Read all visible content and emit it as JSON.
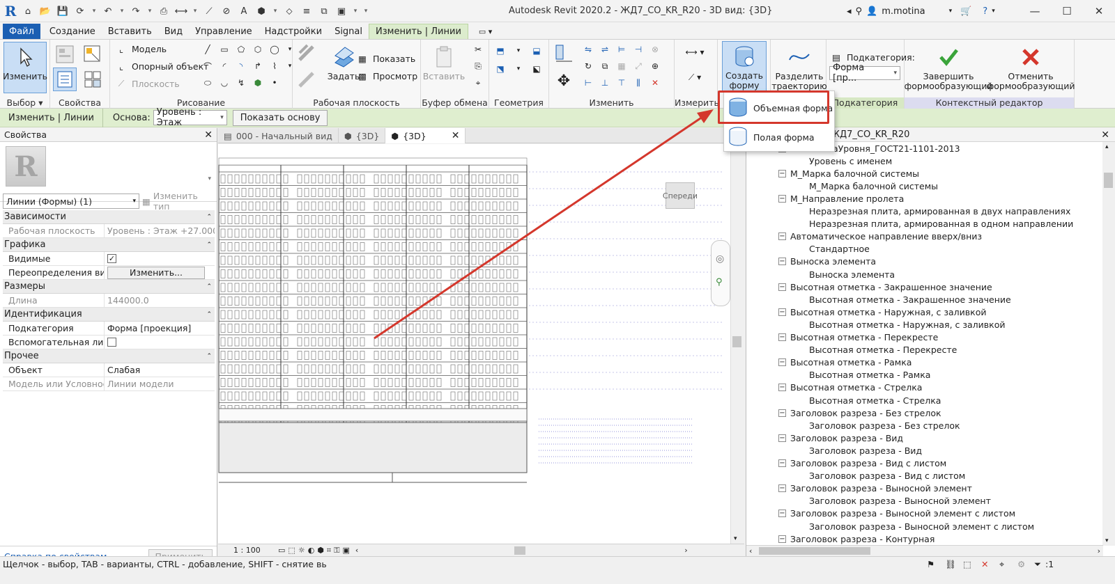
{
  "app": {
    "title": "Autodesk Revit 2020.2 - ЖД7_CO_KR_R20 - 3D вид: {3D}",
    "user": "m.motina"
  },
  "ribbon_tabs": [
    {
      "label": "Файл"
    },
    {
      "label": "Создание"
    },
    {
      "label": "Вставить"
    },
    {
      "label": "Вид"
    },
    {
      "label": "Управление"
    },
    {
      "label": "Надстройки"
    },
    {
      "label": "Signal"
    },
    {
      "label": "Изменить | Линии"
    }
  ],
  "ribbon": {
    "modify_label": "Изменить",
    "select_panel": "Выбор",
    "properties_panel": "Свойства",
    "draw": {
      "model": "Модель",
      "ref": "Опорный объект",
      "plane": "Плоскость",
      "panel": "Рисование"
    },
    "workplane": {
      "show": "Показать",
      "set": "Задать",
      "viewer": "Просмотр",
      "panel": "Рабочая плоскость"
    },
    "clipboard": {
      "paste": "Вставить",
      "panel": "Буфер обмена"
    },
    "geometry_panel": "Геометрия",
    "modify_panel": "Изменить",
    "measure_panel": "Измерить",
    "create_form": "Создать форму",
    "divide_path": "Разделить траекторию",
    "subcategory": {
      "label": "Подкатегория:",
      "value": "Форма [пр...",
      "panel": "Подкатегория"
    },
    "finish": "Завершить формообразующий",
    "cancel": "Отменить формообразующий",
    "context_panel": "Контекстный редактор"
  },
  "options_bar": {
    "context": "Изменить | Линии",
    "base_label": "Основа:",
    "base_value": "Уровень : Этаж",
    "show_base": "Показать основу"
  },
  "dropdown": {
    "solid": "Объемная форма",
    "void": "Полая форма"
  },
  "properties": {
    "title": "Свойства",
    "type_selector": "Линии (Формы) (1)",
    "edit_type": "Изменить тип",
    "groups": [
      {
        "name": "Зависимости",
        "rows": [
          {
            "k": "Рабочая плоскость",
            "v": "Уровень : Этаж +27.000..."
          }
        ]
      },
      {
        "name": "Графика",
        "rows": [
          {
            "k": "Видимые",
            "v": "✓"
          },
          {
            "k": "Переопределения ви...",
            "v": "Изменить..."
          }
        ]
      },
      {
        "name": "Размеры",
        "rows": [
          {
            "k": "Длина",
            "v": "144000.0"
          }
        ]
      },
      {
        "name": "Идентификация",
        "rows": [
          {
            "k": "Подкатегория",
            "v": "Форма [проекция]"
          },
          {
            "k": "Вспомогательная лин...",
            "v": ""
          }
        ]
      },
      {
        "name": "Прочее",
        "rows": [
          {
            "k": "Объект",
            "v": "Слабая"
          },
          {
            "k": "Модель или Условное",
            "v": "Линии модели"
          }
        ]
      }
    ],
    "help_link": "Справка по свойствам",
    "apply": "Применить"
  },
  "view_tabs": [
    {
      "label": "000 - Начальный вид"
    },
    {
      "label": "{3D}"
    },
    {
      "label": "{3D}"
    }
  ],
  "viewcube_label": "Спереди",
  "view_control": {
    "scale": "1 : 100"
  },
  "browser": {
    "title": "ЖД7_CO_KR_R20",
    "items": [
      {
        "label": "...ОтметкаУровня_ГОСТ21-1101-2013",
        "level": 1
      },
      {
        "label": "Уровень с именем",
        "level": 2
      },
      {
        "label": "М_Марка балочной системы",
        "level": 1
      },
      {
        "label": "М_Марка балочной системы",
        "level": 2
      },
      {
        "label": "М_Направление пролета",
        "level": 1
      },
      {
        "label": "Неразрезная плита, армированная в двух направлениях",
        "level": 2
      },
      {
        "label": "Неразрезная плита, армированная в одном направлении",
        "level": 2
      },
      {
        "label": "Автоматическое направление вверх/вниз",
        "level": 1
      },
      {
        "label": "Стандартное",
        "level": 2
      },
      {
        "label": "Выноска элемента",
        "level": 1
      },
      {
        "label": "Выноска элемента",
        "level": 2
      },
      {
        "label": "Высотная отметка - Закрашенное значение",
        "level": 1
      },
      {
        "label": "Высотная отметка - Закрашенное значение",
        "level": 2
      },
      {
        "label": "Высотная отметка - Наружная, с заливкой",
        "level": 1
      },
      {
        "label": "Высотная отметка - Наружная, с заливкой",
        "level": 2
      },
      {
        "label": "Высотная отметка - Перекресте",
        "level": 1
      },
      {
        "label": "Высотная отметка - Перекресте",
        "level": 2
      },
      {
        "label": "Высотная отметка - Рамка",
        "level": 1
      },
      {
        "label": "Высотная отметка - Рамка",
        "level": 2
      },
      {
        "label": "Высотная отметка - Стрелка",
        "level": 1
      },
      {
        "label": "Высотная отметка - Стрелка",
        "level": 2
      },
      {
        "label": "Заголовок разреза - Без стрелок",
        "level": 1
      },
      {
        "label": "Заголовок разреза - Без стрелок",
        "level": 2
      },
      {
        "label": "Заголовок разреза - Вид",
        "level": 1
      },
      {
        "label": "Заголовок разреза - Вид",
        "level": 2
      },
      {
        "label": "Заголовок разреза - Вид с листом",
        "level": 1
      },
      {
        "label": "Заголовок разреза - Вид с листом",
        "level": 2
      },
      {
        "label": "Заголовок разреза - Выносной элемент",
        "level": 1
      },
      {
        "label": "Заголовок разреза - Выносной элемент",
        "level": 2
      },
      {
        "label": "Заголовок разреза - Выносной элемент с листом",
        "level": 1
      },
      {
        "label": "Заголовок разреза - Выносной элемент с листом",
        "level": 2
      },
      {
        "label": "Заголовок разреза - Контурная",
        "level": 1
      }
    ]
  },
  "status": {
    "hint": "Щелчок - выбор, TAB - варианты, CTRL - добавление, SHIFT - снятие вь",
    "filter_count": ":1"
  },
  "colors": {
    "accent": "#1b5fb3",
    "highlight": "#d4372c",
    "context_tab": "#dceccd"
  }
}
